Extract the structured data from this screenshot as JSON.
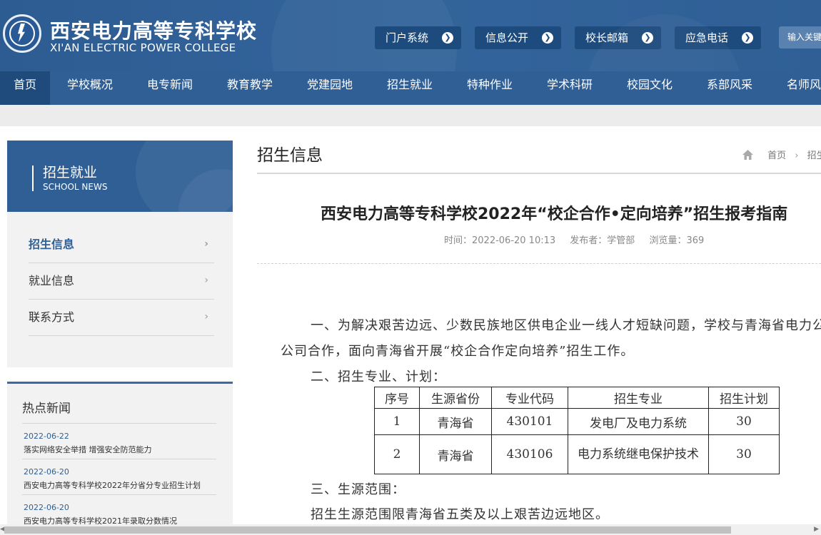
{
  "header": {
    "school_cn": "西安电力高等专科学校",
    "school_en": "XI'AN ELECTRIC POWER COLLEGE",
    "quick_links": [
      "门户系统",
      "信息公开",
      "校长邮箱",
      "应急电话"
    ],
    "search_placeholder": "输入关键字"
  },
  "nav": [
    "首页",
    "学校概况",
    "电专新闻",
    "教育教学",
    "党建园地",
    "招生就业",
    "特种作业",
    "学术科研",
    "校园文化",
    "系部风采",
    "名师风采"
  ],
  "sidebar": {
    "title": "招生就业",
    "subtitle": "SCHOOL NEWS",
    "menu": [
      "招生信息",
      "就业信息",
      "联系方式"
    ],
    "hot_title": "热点新闻",
    "hot_news": [
      {
        "date": "2022-06-22",
        "title": "落实网络安全举措 增强安全防范能力"
      },
      {
        "date": "2022-06-20",
        "title": "西安电力高等专科学校2022年分省分专业招生计划"
      },
      {
        "date": "2022-06-20",
        "title": "西安电力高等专科学校2021年录取分数情况"
      }
    ]
  },
  "main": {
    "page_title": "招生信息",
    "breadcrumb": [
      "首页",
      "招生信息"
    ],
    "article_title": "西安电力高等专科学校2022年“校企合作•定向培养”招生报考指南",
    "meta": {
      "time": "时间：2022-06-20 10:13",
      "publisher": "发布者：学管部",
      "views": "浏览量：369"
    },
    "p1a": "一、为解决艰苦边远、少数民族地区供电企业一线人才短缺问题，学校与青海省电力公司",
    "p1b": "公司合作，面向青海省开展“校企合作定向培养”招生工作。",
    "p2": "二、招生专业、计划：",
    "table": {
      "headers": [
        "序号",
        "生源省份",
        "专业代码",
        "招生专业",
        "招生计划"
      ],
      "rows": [
        [
          "1",
          "青海省",
          "430101",
          "发电厂及电力系统",
          "30"
        ],
        [
          "2",
          "青海省",
          "430106",
          "电力系统继电保护技术",
          "30"
        ]
      ]
    },
    "p3": "三、生源范围：",
    "p4": "招生生源范围限青海省五类及以上艰苦边远地区。"
  }
}
